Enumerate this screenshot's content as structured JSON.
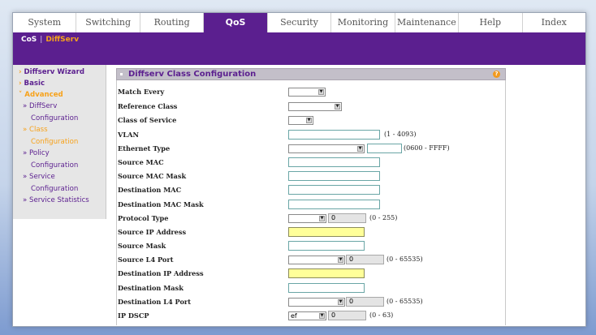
{
  "main_tabs": [
    "System",
    "Switching",
    "Routing",
    "QoS",
    "Security",
    "Monitoring",
    "Maintenance",
    "Help",
    "Index"
  ],
  "active_tab": "QoS",
  "subnav": {
    "cos": "CoS",
    "separator": "|",
    "diffserv": "DiffServ"
  },
  "sidebar": {
    "wizard": "Diffserv Wizard",
    "basic": "Basic",
    "advanced": "Advanced",
    "sub": [
      "» DiffServ",
      "Configuration",
      "» Class",
      "Configuration",
      "» Policy",
      "Configuration",
      "» Service",
      "Configuration",
      "» Service Statistics"
    ]
  },
  "panel": {
    "title": "Diffserv Class Configuration",
    "help": "?"
  },
  "form": {
    "match_every": "Match Every",
    "reference_class": "Reference Class",
    "class_of_service": "Class of Service",
    "vlan": "VLAN",
    "vlan_hint": "(1 - 4093)",
    "ethernet_type": "Ethernet Type",
    "ethernet_type_hint": "(0600 - FFFF)",
    "source_mac": "Source MAC",
    "source_mac_mask": "Source MAC Mask",
    "destination_mac": "Destination MAC",
    "destination_mac_mask": "Destination MAC Mask",
    "protocol_type": "Protocol Type",
    "protocol_value": "0",
    "protocol_hint": "(0 - 255)",
    "source_ip": "Source IP Address",
    "source_mask": "Source Mask",
    "source_l4_port": "Source L4 Port",
    "source_l4_value": "0",
    "source_l4_hint": "(0 - 65535)",
    "destination_ip": "Destination IP Address",
    "destination_mask": "Destination Mask",
    "destination_l4_port": "Destination L4 Port",
    "destination_l4_value": "0",
    "destination_l4_hint": "(0 - 65535)",
    "ip_dscp": "IP DSCP",
    "ip_dscp_select": "ef",
    "ip_dscp_value": "0",
    "ip_dscp_hint": "(0 - 63)"
  },
  "colors": {
    "brand_purple": "#5b1f8f",
    "accent_orange": "#f7a21b",
    "highlight_yellow": "#ffff99"
  }
}
